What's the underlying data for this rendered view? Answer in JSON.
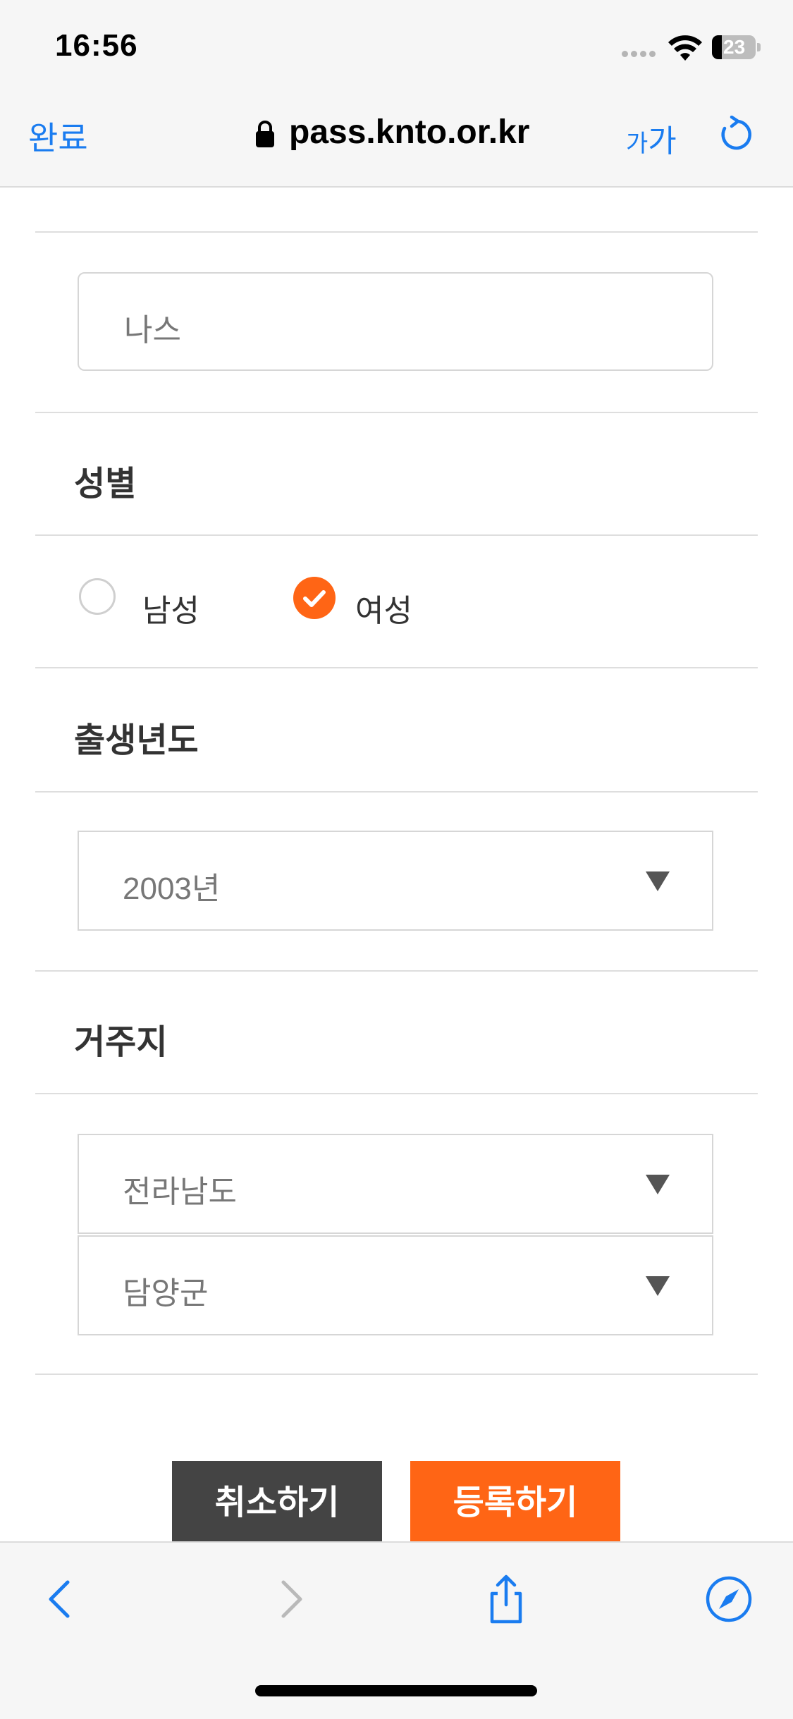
{
  "status_bar": {
    "time": "16:56",
    "battery": "23",
    "icons": [
      "signal-icon",
      "wifi-icon",
      "battery-icon"
    ]
  },
  "browser": {
    "done_label": "완료",
    "url": "pass.knto.or.kr",
    "text_size_label_small": "가",
    "text_size_label_large": "가",
    "icons": [
      "lock-icon",
      "reload-icon"
    ]
  },
  "form": {
    "name": {
      "value": "나스"
    },
    "gender": {
      "title": "성별",
      "options": [
        {
          "label": "남성",
          "selected": false
        },
        {
          "label": "여성",
          "selected": true
        }
      ]
    },
    "birth_year": {
      "title": "출생년도",
      "value": "2003년"
    },
    "residence": {
      "title": "거주지",
      "province": "전라남도",
      "district": "담양군"
    },
    "buttons": {
      "cancel": "취소하기",
      "submit": "등록하기"
    }
  },
  "toolbar": {
    "icons": [
      "back-icon",
      "forward-icon",
      "share-icon",
      "compass-icon"
    ]
  },
  "colors": {
    "accent": "#ff6515",
    "link": "#1a7cf0",
    "cancel_button": "#444444"
  }
}
